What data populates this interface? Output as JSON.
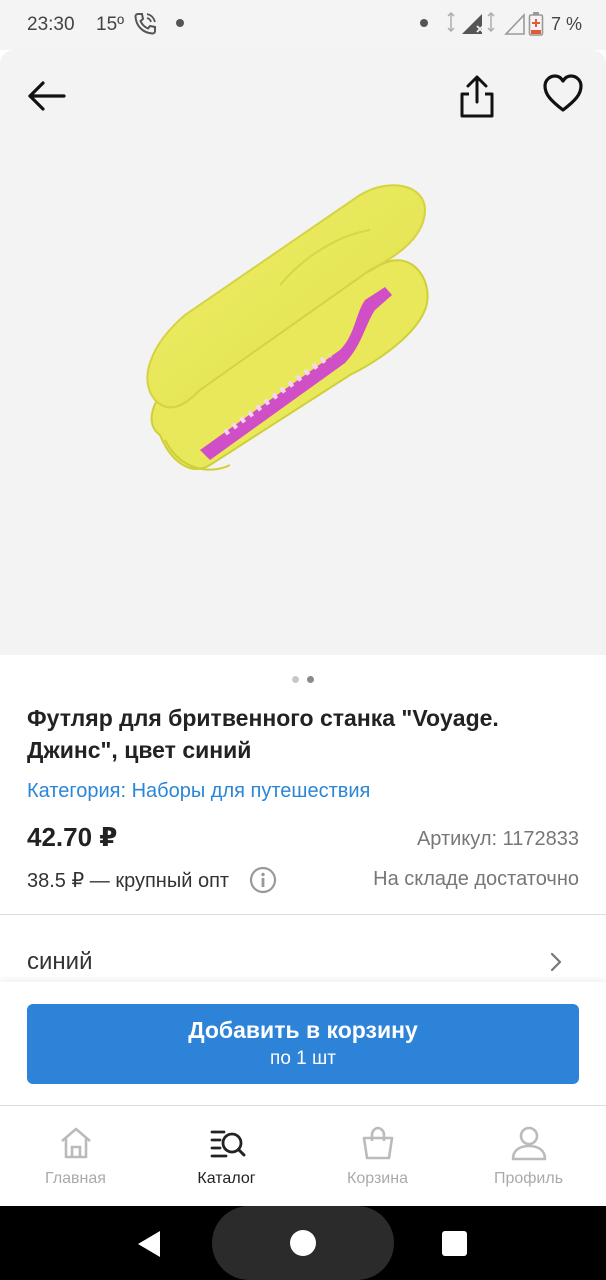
{
  "status_bar": {
    "time": "23:30",
    "temperature": "15º",
    "battery": "7 %"
  },
  "product": {
    "title": "Футляр для бритвенного станка \"Voyage. Джинс\", цвет синий",
    "category": "Категория: Наборы для путешествия",
    "price": "42.70 ₽",
    "article": "Артикул: 1172833",
    "bulk_price": "38.5 ₽ — крупный опт",
    "stock": "На складе достаточно",
    "variant": "синий",
    "image_count": 2,
    "active_image_index": 2
  },
  "cart_button": {
    "label": "Добавить в корзину",
    "sub_label": "по 1 шт"
  },
  "tabs": [
    {
      "label": "Главная",
      "icon": "home-icon",
      "active": false
    },
    {
      "label": "Каталог",
      "icon": "catalog-search-icon",
      "active": true
    },
    {
      "label": "Корзина",
      "icon": "shopping-bag-icon",
      "active": false
    },
    {
      "label": "Профиль",
      "icon": "profile-icon",
      "active": false
    }
  ],
  "colors": {
    "accent": "#2d83d8",
    "link": "#2b86d6",
    "tab_inactive": "#aaaaaa",
    "tab_active": "#222222"
  }
}
